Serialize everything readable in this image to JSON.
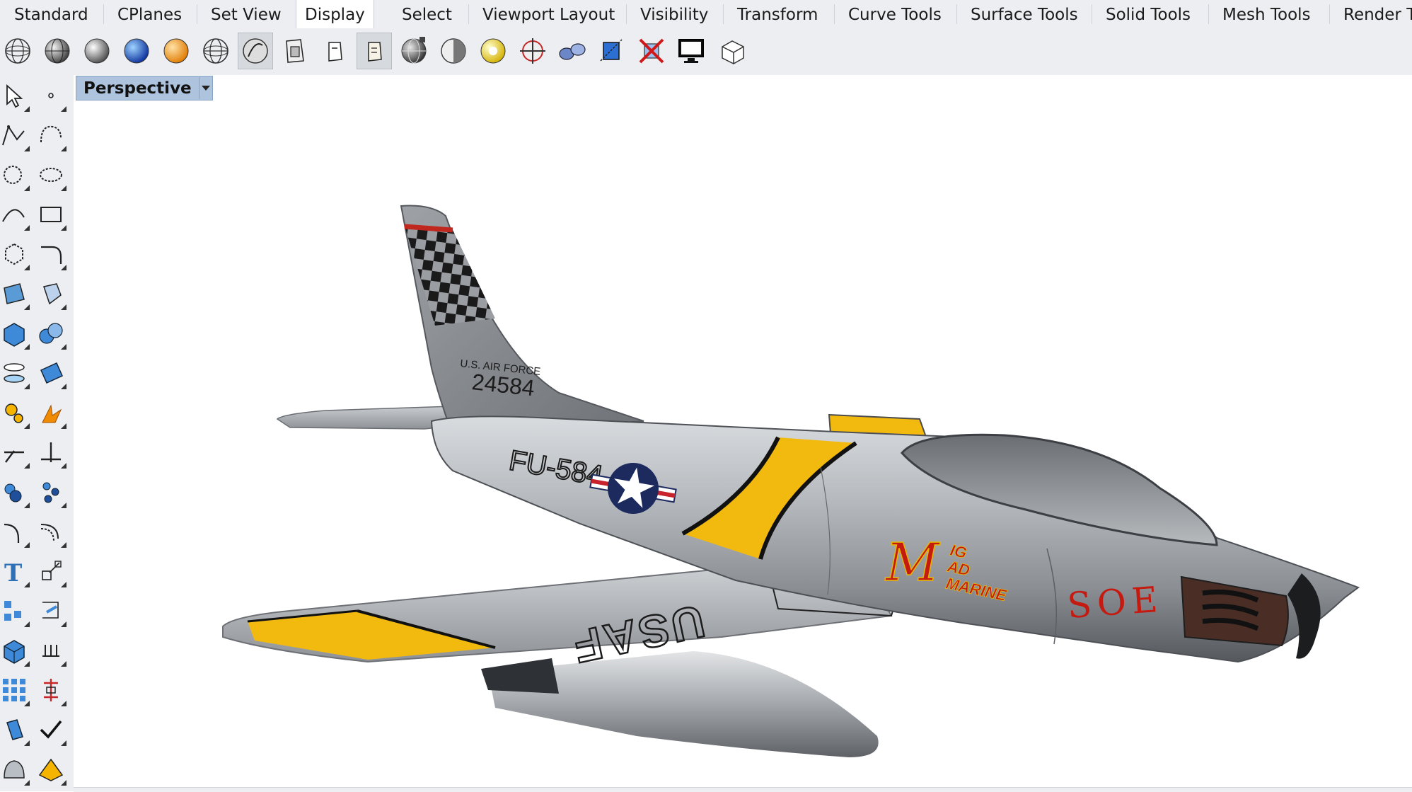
{
  "tabs": [
    {
      "label": "Standard",
      "active": false
    },
    {
      "label": "CPlanes",
      "active": false
    },
    {
      "label": "Set View",
      "active": false
    },
    {
      "label": "Display",
      "active": true
    },
    {
      "label": "Select",
      "active": false
    },
    {
      "label": "Viewport Layout",
      "active": false
    },
    {
      "label": "Visibility",
      "active": false
    },
    {
      "label": "Transform",
      "active": false
    },
    {
      "label": "Curve Tools",
      "active": false
    },
    {
      "label": "Surface Tools",
      "active": false
    },
    {
      "label": "Solid Tools",
      "active": false
    },
    {
      "label": "Mesh Tools",
      "active": false
    },
    {
      "label": "Render T",
      "active": false
    }
  ],
  "display_toolbar": [
    "wireframe-mode-icon",
    "shaded-mode-icon",
    "rendered-mode-icon",
    "ghosted-blue-mode-icon",
    "orange-sphere-mode-icon",
    "xray-mode-icon",
    "technical-mode-icon",
    "artistic-mode-icon",
    "pen-mode-icon",
    "arctic-mode-icon",
    "shaded-sphere-grid-icon",
    "half-shaded-sphere-icon",
    "light-sphere-icon",
    "zebra-target-icon",
    "environment-map-icon",
    "clipping-plane-icon",
    "hide-cross-icon",
    "monitor-icon",
    "box-outline-icon"
  ],
  "left_toolbar": [
    [
      "select-arrow-icon",
      "point-icon"
    ],
    [
      "polyline-icon",
      "curve-interpolate-icon"
    ],
    [
      "circle-icon",
      "ellipse-icon"
    ],
    [
      "arc-icon",
      "rectangle-icon"
    ],
    [
      "polygon-icon",
      "fillet-curve-icon"
    ],
    [
      "surface-from-points-icon",
      "extrude-surface-icon"
    ],
    [
      "box-solid-icon",
      "boolean-union-icon"
    ],
    [
      "cylinder-mesh-icon",
      "mesh-plane-icon"
    ],
    [
      "gear-explode-icon",
      "explode-orange-icon"
    ],
    [
      "trim-icon",
      "split-icon"
    ],
    [
      "group-icon",
      "ungroup-icon"
    ],
    [
      "curve-fillet-icon",
      "offset-curve-icon"
    ],
    [
      "text-icon",
      "scale-icon"
    ],
    [
      "array-icon",
      "dimension-icon"
    ],
    [
      "solid-box-icon",
      "extrude-curve-icon"
    ],
    [
      "grid-array-icon",
      "gumball-icon"
    ],
    [
      "cylinder-icon",
      "check-icon"
    ],
    [
      "sphere-icon",
      "solid-pyramid-icon"
    ]
  ],
  "viewport": {
    "label": "Perspective",
    "background": "#ffffff"
  },
  "aircraft": {
    "tail_text_top": "U.S. AIR FORCE",
    "tail_number": "24584",
    "fuselage_code": "FU-584",
    "wing_text": "USAF",
    "nose_text": "SOE",
    "nose_art_initial": "M",
    "nose_art_line1": "IG",
    "nose_art_line2": "AD",
    "nose_art_line3": "MARINE"
  },
  "colors": {
    "accent_yellow": "#f2b90f",
    "viewport_label_bg": "#aec4de",
    "tab_bg": "#eceef2",
    "nose_art_red": "#c41a10",
    "metal": "#9a9ea3"
  }
}
